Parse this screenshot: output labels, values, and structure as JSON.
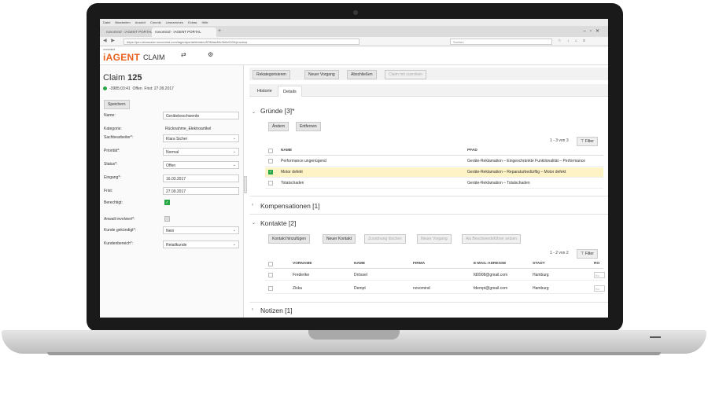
{
  "browser": {
    "menu": [
      "Datei",
      "Bearbeiten",
      "Ansicht",
      "Chronik",
      "Lesezeichen",
      "Extras",
      "Hilfe"
    ],
    "tabs": [
      "novomind - iAGENT PORTAL",
      "novomind - iAGENT PORTAL"
    ],
    "url": "https://pm-showcase.novomind.com/iagentportal/#/claim/5758ae48c3b0c0000/process",
    "search_placeholder": "Suchen"
  },
  "app": {
    "brand_small": "novomind",
    "brand": "iAGENT",
    "module": "CLAIM"
  },
  "claim": {
    "title_prefix": "Claim ",
    "number": "125",
    "status": "-3985:03:41",
    "state": "Offen",
    "deadline": "Frist: 27.09.2017",
    "save_label": "Speichern",
    "fields": {
      "name_label": "Name:",
      "name_value": "Gerätebeschwerde",
      "category_label": "Kategorie:",
      "category_value": "Rücknahme_Elektroartikel",
      "agent_label": "Sachbearbeiter*:",
      "agent_value": "Klara Sicher",
      "priority_label": "Priorität*:",
      "priority_value": "Normal",
      "status_label": "Status*:",
      "status_value": "Offen",
      "received_label": "Eingang*:",
      "received_value": "16.03.2017",
      "due_label": "Frist:",
      "due_value": "27.09.2017",
      "justified_label": "Berechtigt:",
      "lawyer_label": "Anwalt involviert*:",
      "cancelled_label": "Kunde gekündigt*:",
      "cancelled_value": "Nein",
      "segment_label": "Kundenbereich*:",
      "segment_value": "Retailkunde"
    }
  },
  "actions": [
    "Rekategorisieren",
    "Neuer Vorgang",
    "Abschließen",
    "Claim mit zuordnen"
  ],
  "tabs": [
    "Historie",
    "Details"
  ],
  "reasons": {
    "title": "Gründe [3]*",
    "buttons": [
      "Ändern",
      "Entfernen"
    ],
    "count": "1 - 3 von 3",
    "filter": "Filter",
    "headers": [
      "NAME",
      "PFAD"
    ],
    "rows": [
      {
        "name": "Performance ungenügend",
        "path": "Geräte-Reklamation – Eingeschränkte Funktionalität – Performance"
      },
      {
        "name": "Motor defekt",
        "path": "Geräte-Reklamation – Reparaturbedürftig – Motor defekt"
      },
      {
        "name": "Totalschaden",
        "path": "Geräte-Reklamation – Totalschaden"
      }
    ]
  },
  "compensations": {
    "title": "Kompensationen [1]"
  },
  "contacts": {
    "title": "Kontakte [2]",
    "buttons": [
      "Kontakt hinzufügen",
      "Neuer Kontakt",
      "Zuordnung löschen",
      "Neuer Vorgang",
      "Als Beschwerdeführer setzen"
    ],
    "count": "1 - 2 von 2",
    "filter": "Filter",
    "headers": [
      "VORNAME",
      "NAME",
      "FIRMA",
      "E-MAIL-ADRESSE",
      "STADT",
      "RO"
    ],
    "rows": [
      {
        "first": "Frederike",
        "last": "Drössel",
        "company": "",
        "email": "fd0908@gmail.com",
        "city": "Hamburg",
        "ro": "Ku"
      },
      {
        "first": "Ziska",
        "last": "Dempt",
        "company": "novomind",
        "email": "fdempt@gmail.com",
        "city": "Hamburg",
        "ro": "Ku"
      }
    ]
  },
  "notes": {
    "title": "Notizen [1]"
  }
}
